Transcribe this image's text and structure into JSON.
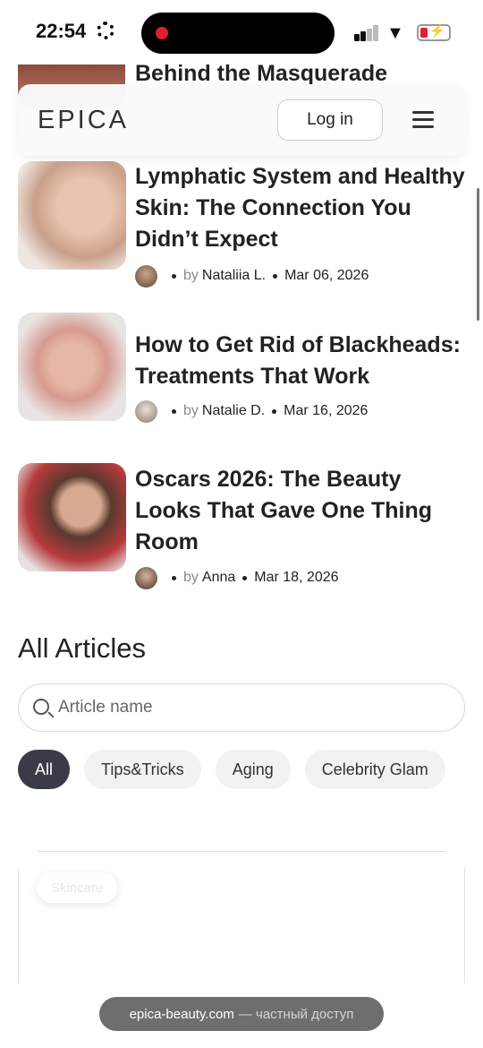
{
  "status_bar": {
    "time": "22:54"
  },
  "peek_article": {
    "title": "Behind the Masquerade"
  },
  "header": {
    "logo": "EPICA",
    "login_label": "Log in"
  },
  "articles": [
    {
      "title": "Lymphatic System and Healthy Skin: The Connection You Didn’t Expect",
      "by": "by",
      "author": "Nataliia L.",
      "date": "Mar 06, 2026"
    },
    {
      "title": "How to Get Rid of Blackheads: Treatments That Work",
      "by": "by",
      "author": "Natalie D.",
      "date": "Mar 16, 2026"
    },
    {
      "title": "Oscars 2026: The Beauty Looks That Gave One Thing Room",
      "by": "by",
      "author": "Anna",
      "date": "Mar 18, 2026"
    }
  ],
  "all_articles": {
    "title": "All Articles",
    "search_placeholder": "Article name",
    "chips": [
      "All",
      "Tips&Tricks",
      "Aging",
      "Celebrity Glam"
    ],
    "active_chip": "All"
  },
  "next_card": {
    "tag": "Skincare"
  },
  "browser": {
    "domain": "epica-beauty.com",
    "note": "— частный доступ"
  }
}
